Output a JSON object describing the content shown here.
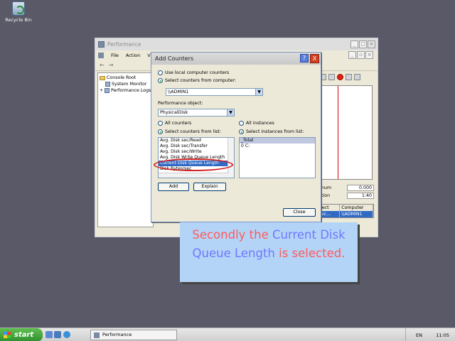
{
  "desktop": {
    "recycle_label": "Recycle Bin"
  },
  "perf_window": {
    "title": "Performance",
    "menu": [
      "File",
      "Action",
      "View"
    ],
    "toolbar_glyphs": [
      "←",
      "→"
    ],
    "tree": [
      {
        "label": "Console Root"
      },
      {
        "label": "System Monitor"
      },
      {
        "label": "Performance Logs"
      }
    ],
    "stats": [
      {
        "label": "num",
        "value": "0.000"
      },
      {
        "label": "tion",
        "value": "1:40"
      }
    ],
    "legend": {
      "headers": [
        "bject",
        "Computer"
      ],
      "row": [
        "ysic...",
        "\\\\ADMIN1"
      ]
    }
  },
  "dialog": {
    "title": "Add Counters",
    "help_glyph": "?",
    "close_glyph": "X",
    "radio_local": "Use local computer counters",
    "radio_select_computer": "Select counters from computer:",
    "computer_value": "\\\\ADMIN1",
    "perf_object_label": "Performance object:",
    "perf_object_value": "PhysicalDisk",
    "radio_all_counters": "All counters",
    "radio_counters_list": "Select counters from list:",
    "radio_all_instances": "All instances",
    "radio_instances_list": "Select instances from list:",
    "counters": [
      "Avg. Disk sec/Read",
      "Avg. Disk sec/Transfer",
      "Avg. Disk sec/Write",
      "Avg. Disk Write Queue Length",
      "Current Disk Queue Length",
      "Disk Bytes/sec"
    ],
    "instances": [
      "_Total",
      "0 C:"
    ],
    "add_label": "Add",
    "explain_label": "Explain",
    "close_label": "Close"
  },
  "caption": {
    "part1": "Secondly the ",
    "part2": "Current Disk Queue Length",
    "part3": " is selected."
  },
  "taskbar": {
    "start_label": "start",
    "task_label": "Performance",
    "lang": "EN",
    "clock": "11:05"
  },
  "colors": {
    "caption_red": "#ff5a5a",
    "caption_blue": "#6e78ff",
    "highlight": "#316ac5",
    "oval": "#d02020"
  }
}
